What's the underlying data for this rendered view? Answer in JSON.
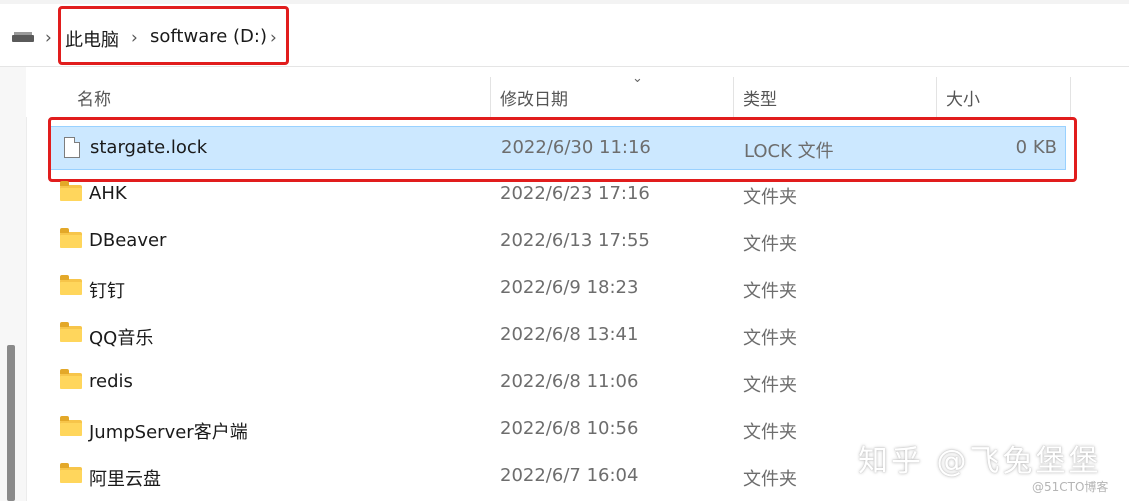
{
  "breadcrumb": {
    "drive_icon": "drive-icon",
    "items": [
      "此电脑",
      "software (D:)"
    ],
    "separator": "›"
  },
  "columns": {
    "name": "名称",
    "date": "修改日期",
    "type": "类型",
    "size": "大小",
    "sort_indicator": "⌄"
  },
  "files": [
    {
      "name": "stargate.lock",
      "date": "2022/6/30 11:16",
      "type": "LOCK 文件",
      "size": "0 KB",
      "icon": "file-icon",
      "selected": true
    },
    {
      "name": "AHK",
      "date": "2022/6/23 17:16",
      "type": "文件夹",
      "size": "",
      "icon": "folder-icon"
    },
    {
      "name": "DBeaver",
      "date": "2022/6/13 17:55",
      "type": "文件夹",
      "size": "",
      "icon": "folder-icon"
    },
    {
      "name": "钉钉",
      "date": "2022/6/9 18:23",
      "type": "文件夹",
      "size": "",
      "icon": "folder-icon"
    },
    {
      "name": "QQ音乐",
      "date": "2022/6/8 13:41",
      "type": "文件夹",
      "size": "",
      "icon": "folder-icon"
    },
    {
      "name": "redis",
      "date": "2022/6/8 11:06",
      "type": "文件夹",
      "size": "",
      "icon": "folder-icon"
    },
    {
      "name": "JumpServer客户端",
      "date": "2022/6/8 10:56",
      "type": "文件夹",
      "size": "",
      "icon": "folder-icon"
    },
    {
      "name": "阿里云盘",
      "date": "2022/6/7 16:04",
      "type": "文件夹",
      "size": "",
      "icon": "folder-icon"
    }
  ],
  "annotation_color": "#e11d1d",
  "selection_color": "#cce8ff",
  "watermark": {
    "main": "知乎 @飞兔堡堡",
    "sub": "@51CTO博客"
  }
}
